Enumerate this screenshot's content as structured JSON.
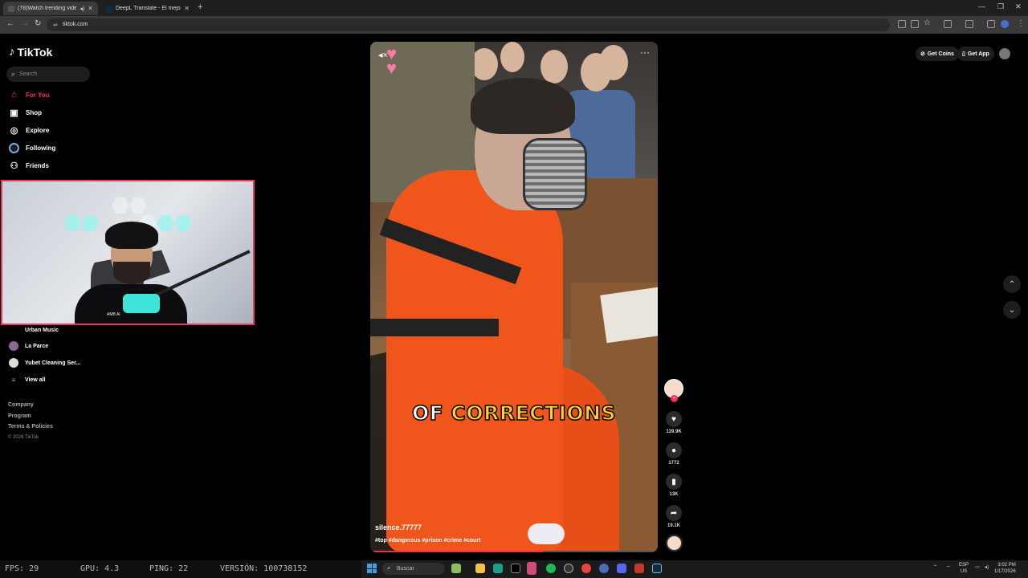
{
  "browser": {
    "tabs": [
      {
        "title": "(78)Watch trending videos",
        "active": true
      },
      {
        "title": "DeepL Translate - El mejor trad",
        "active": false
      }
    ],
    "url": "tiktok.com"
  },
  "sidebar": {
    "logo": "TikTok",
    "search_placeholder": "Search",
    "nav": [
      {
        "label": "For You",
        "icon": "home-icon",
        "active": true
      },
      {
        "label": "Shop",
        "icon": "shop-icon"
      },
      {
        "label": "Explore",
        "icon": "compass-icon"
      },
      {
        "label": "Following",
        "icon": "following-icon"
      },
      {
        "label": "Friends",
        "icon": "friends-icon"
      }
    ],
    "following_accounts": [
      {
        "label": "Urban Music"
      },
      {
        "label": "La Parce"
      },
      {
        "label": "Yubet Cleaning Ser..."
      }
    ],
    "view_all": "View all",
    "footer_links": [
      "Company",
      "Program",
      "Terms & Policies"
    ],
    "copyright": "© 2026 TikTok"
  },
  "webcam": {
    "mic_label": "AMB AI"
  },
  "video": {
    "caption_word1": "OF",
    "caption_word2": "CORRECTIONS",
    "author": "silence.77777",
    "hashtags": "#top #dangerous #prison #crime #court",
    "progress_fraction": 0.6
  },
  "actions": {
    "likes": "139.9K",
    "comments": "1772",
    "saves": "13K",
    "shares": "19.1K"
  },
  "header": {
    "get_coins": "Get Coins",
    "get_app": "Get App"
  },
  "stats": {
    "fps": "FPS: 29",
    "gpu": "GPU: 4.3",
    "ping": "PING: 22",
    "version": "VERSIÓN: 100738152"
  },
  "taskbar": {
    "search_placeholder": "Buscar",
    "lang_top": "ESP",
    "lang_bottom": "US",
    "time": "3:02 PM",
    "date": "1/17/2026"
  },
  "colors": {
    "accent": "#fe2c55",
    "caption_highlight": "#ffd21e"
  }
}
